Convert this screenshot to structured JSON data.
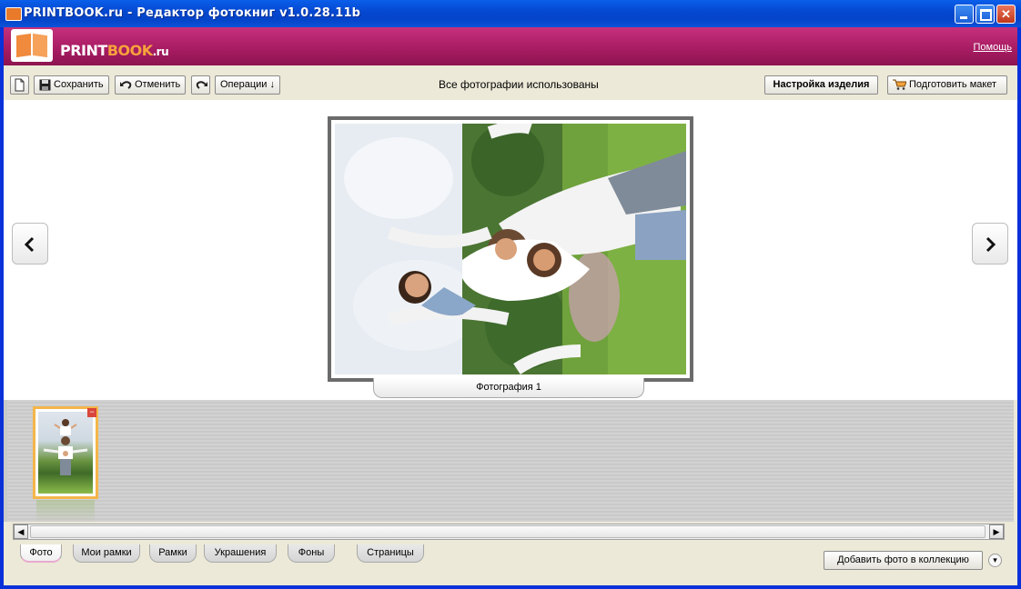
{
  "window": {
    "title": "PRINTBOOK.ru - Редактор фотокниг v1.0.28.11b"
  },
  "header": {
    "brand_part1": "PRINT",
    "brand_part2": "BOOK",
    "brand_part3": ".ru",
    "help_link": "Помощь"
  },
  "toolbar": {
    "save_label": "Сохранить",
    "undo_label": "Отменить",
    "operations_label": "Операции ↓",
    "status_text": "Все фотографии использованы",
    "product_settings_label": "Настройка изделия",
    "prepare_layout_label": "Подготовить макет"
  },
  "editor": {
    "photo_caption": "Фотография  1"
  },
  "strip": {
    "remove_mark": "−"
  },
  "tabs": [
    {
      "label": "Фото",
      "active": true
    },
    {
      "label": "Мои рамки"
    },
    {
      "label": "Рамки"
    },
    {
      "label": "Украшения"
    },
    {
      "label": "Фоны"
    },
    {
      "label": "Страницы"
    }
  ],
  "footer": {
    "add_photo_label": "Добавить фото в коллекцию"
  },
  "icons": {
    "nav_prev": "chevron-left-icon",
    "nav_next": "chevron-right-icon",
    "more": "chevron-down-icon"
  }
}
